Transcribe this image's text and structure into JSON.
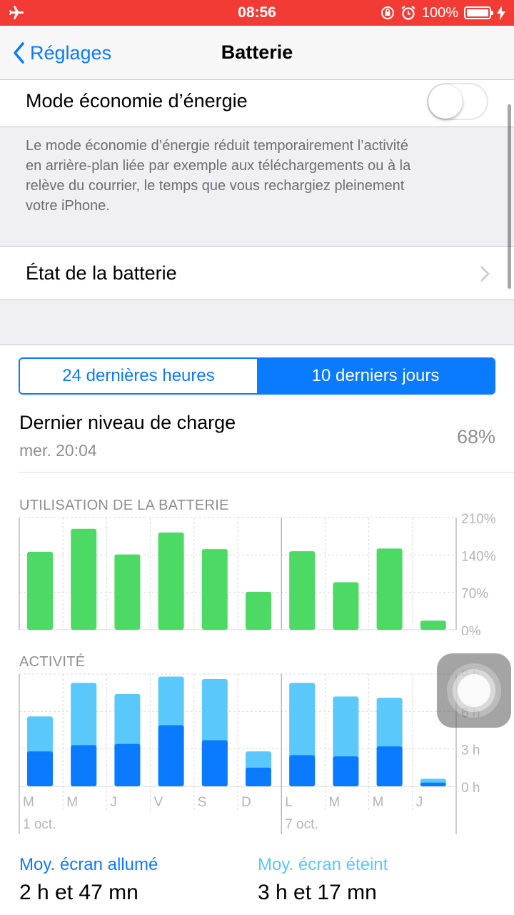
{
  "status_bar": {
    "time": "08:56",
    "battery_percent": "100%",
    "color": "#f23b35"
  },
  "nav": {
    "back_label": "Réglages",
    "title": "Batterie"
  },
  "low_power": {
    "label": "Mode économie d’énergie",
    "enabled": false,
    "footnote_lines": [
      "Le mode économie d’énergie réduit temporairement l’activité",
      "en arrière-plan liée par exemple aux téléchargements ou à la",
      "relève du courrier, le temps que vous rechargiez pleinement",
      "votre iPhone."
    ]
  },
  "battery_health": {
    "label": "État de la batterie"
  },
  "segmented": {
    "options": [
      "24 dernières heures",
      "10 derniers jours"
    ],
    "selected_index": 1
  },
  "last_charge": {
    "label": "Dernier niveau de charge",
    "time": "mer. 20:04",
    "value": "68%"
  },
  "chart_data": [
    {
      "type": "bar",
      "title": "UTILISATION DE LA BATTERIE",
      "categories": [
        "M",
        "M",
        "J",
        "V",
        "S",
        "D",
        "L",
        "M",
        "M",
        "J"
      ],
      "values": [
        146,
        189,
        141,
        182,
        151,
        71,
        147,
        89,
        152,
        17
      ],
      "y_ticks": [
        "210%",
        "140%",
        "70%",
        "0%"
      ],
      "ylim": [
        0,
        210
      ],
      "color": "#4cd964"
    },
    {
      "type": "bar",
      "title": "ACTIVITÉ",
      "categories": [
        "M",
        "M",
        "J",
        "V",
        "S",
        "D",
        "L",
        "M",
        "M",
        "J"
      ],
      "series": [
        {
          "values": [
            2.8,
            3.3,
            3.4,
            4.9,
            3.7,
            1.5,
            2.5,
            2.4,
            3.2,
            0.3
          ],
          "color": "#0a7aff"
        },
        {
          "values": [
            5.6,
            8.3,
            7.4,
            8.8,
            8.6,
            2.8,
            8.3,
            7.2,
            7.1,
            0.6
          ],
          "color": "#5ac8fa"
        }
      ],
      "y_ticks": [
        "9 h",
        "6 h",
        "3 h",
        "0 h"
      ],
      "ylim": [
        0,
        9
      ],
      "week_labels": [
        "1 oct.",
        "7 oct."
      ]
    }
  ],
  "averages": {
    "screen_on_label": "Moy. écran allumé",
    "screen_on_value": "2 h et 47 mn",
    "screen_off_label": "Moy. écran éteint",
    "screen_off_value": "3 h et 17 mn",
    "screen_on_color": "#0a7aff",
    "screen_off_color": "#5ac8fa"
  }
}
